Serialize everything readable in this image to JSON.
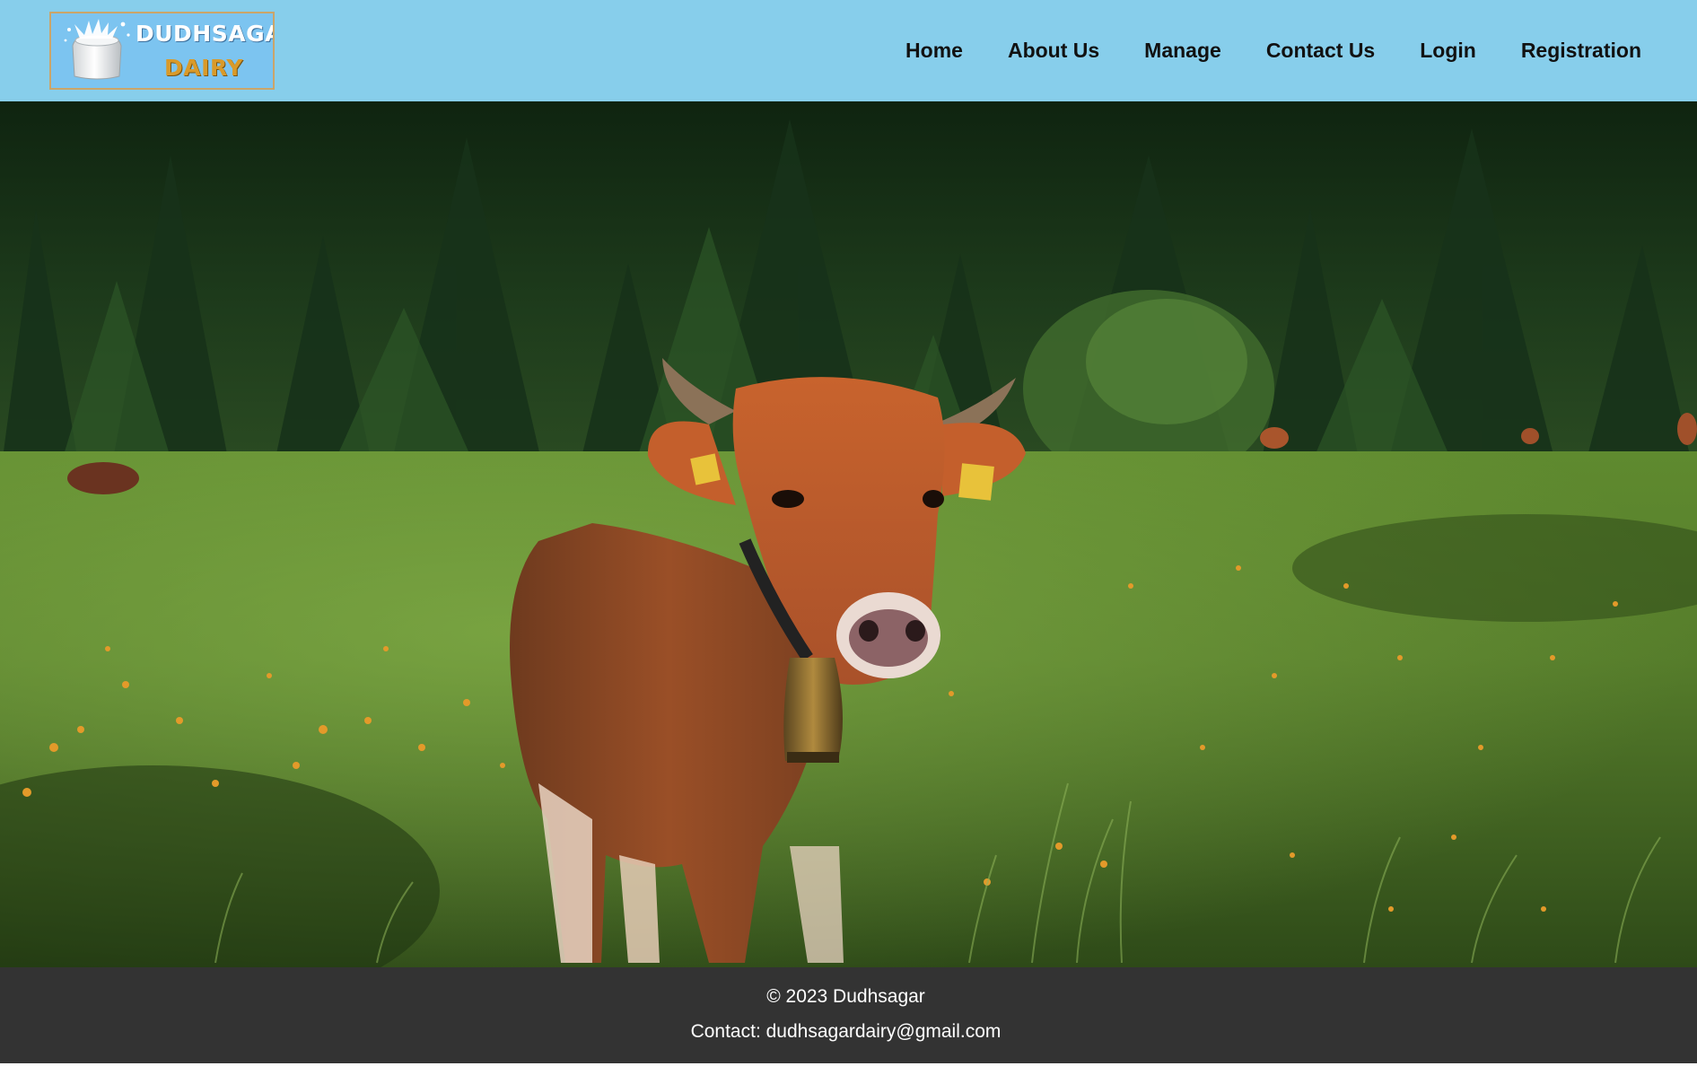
{
  "header": {
    "logo": {
      "line1": "DUDHSAGAR",
      "line2": "DAIRY",
      "icon": "milk-splash-jug-icon"
    },
    "nav": [
      {
        "label": "Home"
      },
      {
        "label": "About Us"
      },
      {
        "label": "Manage"
      },
      {
        "label": "Contact Us"
      },
      {
        "label": "Login"
      },
      {
        "label": "Registration"
      }
    ]
  },
  "hero": {
    "image": "cow-in-meadow-photo"
  },
  "footer": {
    "copyright": "© 2023 Dudhsagar",
    "contact": "Contact: dudhsagardairy@gmail.com"
  },
  "colors": {
    "header_bg": "#87ceeb",
    "footer_bg": "#333333",
    "footer_text": "#ffffff",
    "nav_text": "#111111",
    "logo_line1": "#ffffff",
    "logo_line2": "#d99a2a"
  }
}
